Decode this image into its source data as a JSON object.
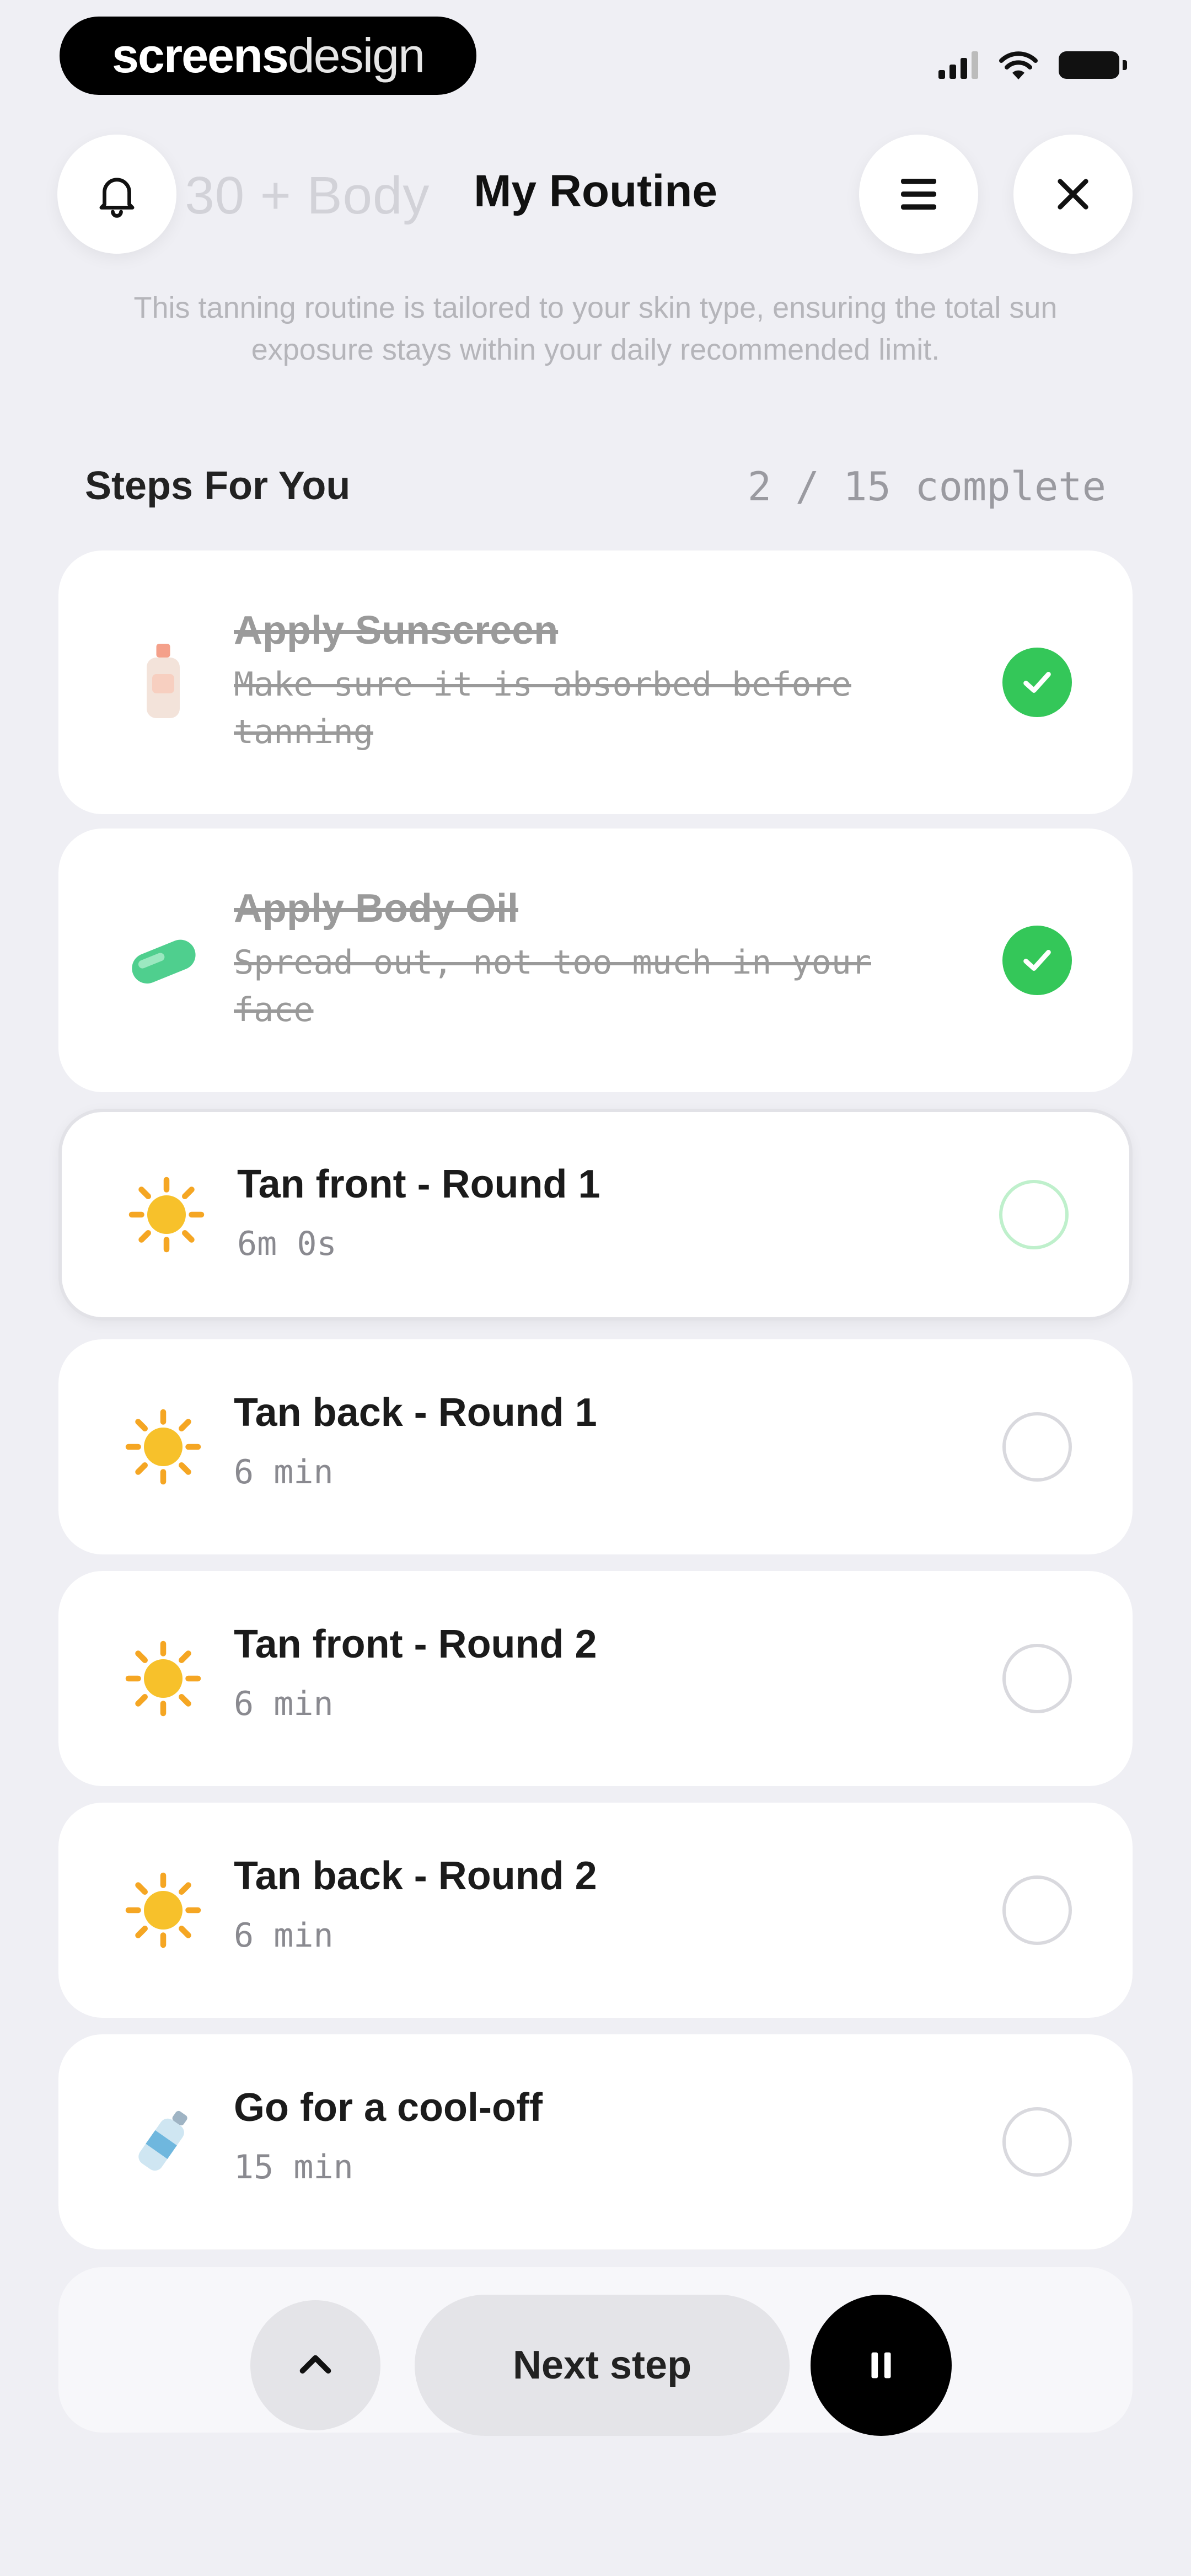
{
  "watermark": {
    "part1": "screens",
    "part2": "design"
  },
  "header": {
    "ghost_text": "/ 30 + Body",
    "title": "My Routine"
  },
  "description": "This tanning routine is tailored to your skin type, ensuring the total sun exposure stays within your daily recommended limit.",
  "steps": {
    "title": "Steps For You",
    "progress": "2 / 15 complete",
    "items": [
      {
        "title": "Apply Sunscreen",
        "subtitle": "Make sure it is absorbed before tanning",
        "icon": "sunscreen-bottle-icon",
        "status": "done"
      },
      {
        "title": "Apply Body Oil",
        "subtitle": "Spread out, not too much in your face",
        "icon": "body-oil-icon",
        "status": "done"
      },
      {
        "title": "Tan front - Round 1",
        "subtitle": "6m 0s",
        "icon": "sun-icon",
        "status": "current"
      },
      {
        "title": "Tan back - Round 1",
        "subtitle": "6 min",
        "icon": "sun-icon",
        "status": "pending"
      },
      {
        "title": "Tan front - Round 2",
        "subtitle": "6 min",
        "icon": "sun-icon",
        "status": "pending"
      },
      {
        "title": "Tan back - Round 2",
        "subtitle": "6 min",
        "icon": "sun-icon",
        "status": "pending"
      },
      {
        "title": "Go for a cool-off",
        "subtitle": "15 min",
        "icon": "water-bottle-icon",
        "status": "pending"
      }
    ]
  },
  "controls": {
    "next_label": "Next step"
  },
  "colors": {
    "accent_green": "#34c759",
    "background": "#efeff4"
  }
}
